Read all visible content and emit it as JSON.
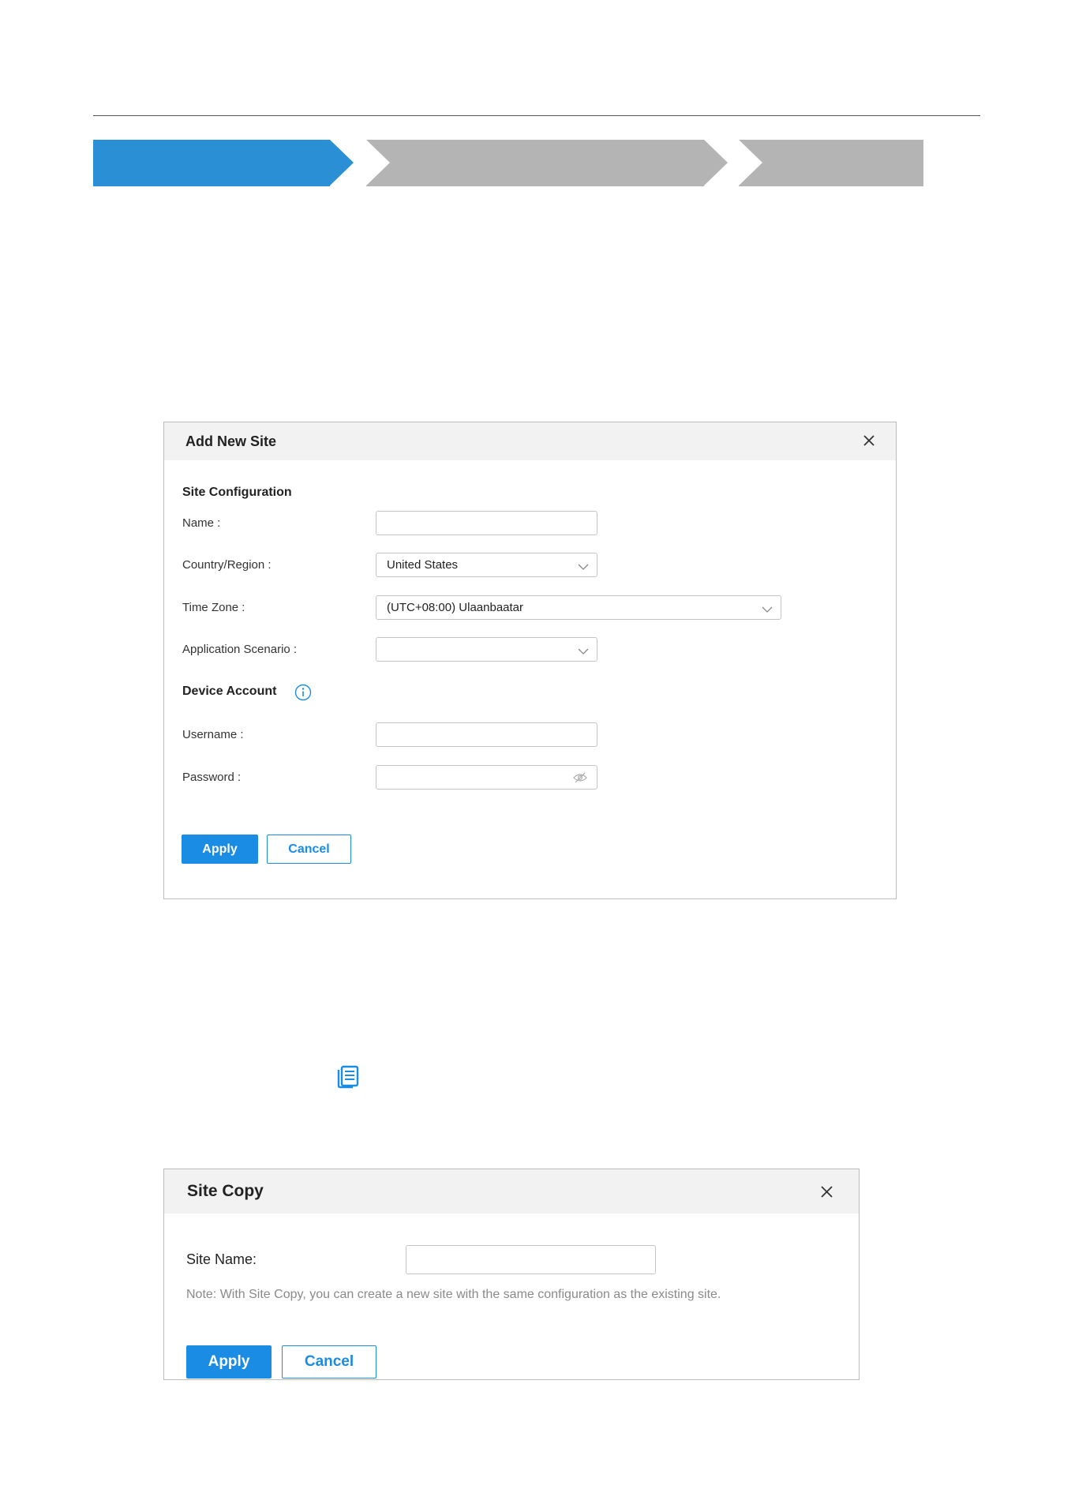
{
  "add_site": {
    "title": "Add New Site",
    "section_site": "Site Configuration",
    "name_label": "Name",
    "name_value": "",
    "country_label": "Country/Region",
    "country_value": "United States",
    "timezone_label": "Time Zone",
    "timezone_value": "(UTC+08:00) Ulaanbaatar",
    "scenario_label": "Application Scenario",
    "scenario_value": "",
    "section_account": "Device Account",
    "username_label": "Username",
    "username_value": "",
    "password_label": "Password",
    "password_value": "",
    "apply_label": "Apply",
    "cancel_label": "Cancel"
  },
  "site_copy": {
    "title": "Site Copy",
    "site_name_label": "Site Name:",
    "site_name_value": "",
    "note": "Note: With Site Copy, you can create a new site with the same configuration as the existing site.",
    "apply_label": "Apply",
    "cancel_label": "Cancel"
  },
  "colors": {
    "accent": "#1a8ce4",
    "step_active": "#2b8fd6",
    "step_inactive": "#b4b4b4"
  },
  "icons": {
    "close": "close-icon",
    "chevron": "chevron-down-icon",
    "info": "info-icon",
    "password_visibility": "eye-off-icon",
    "copy": "copy-icon"
  }
}
